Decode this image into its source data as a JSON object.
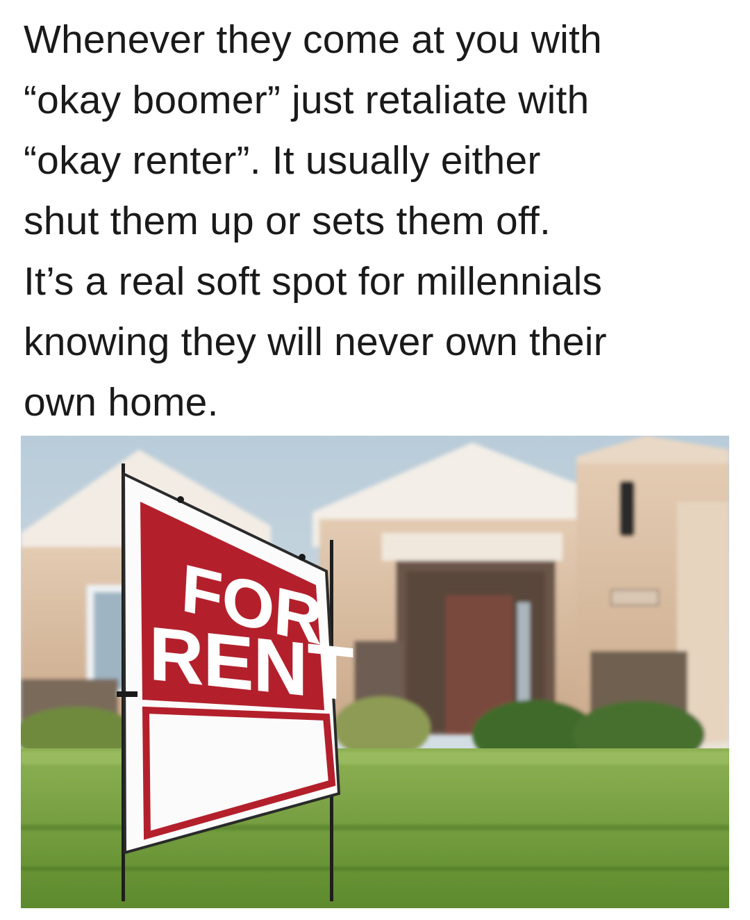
{
  "caption": {
    "lines": [
      "Whenever they come at you with",
      "“okay boomer” just retaliate with",
      "“okay renter”. It usually either",
      "shut them up or sets them off.",
      "It’s a real soft spot for millennials",
      "knowing they will never own their",
      "own home."
    ]
  },
  "photo": {
    "sign": {
      "line1": "FOR",
      "line2": "RENT"
    }
  },
  "colors": {
    "sign_red": "#b3202c",
    "lawn_green": "#6f9a3a",
    "house_stucco": "#d8bfa6",
    "door_brown": "#7a4a3c"
  }
}
